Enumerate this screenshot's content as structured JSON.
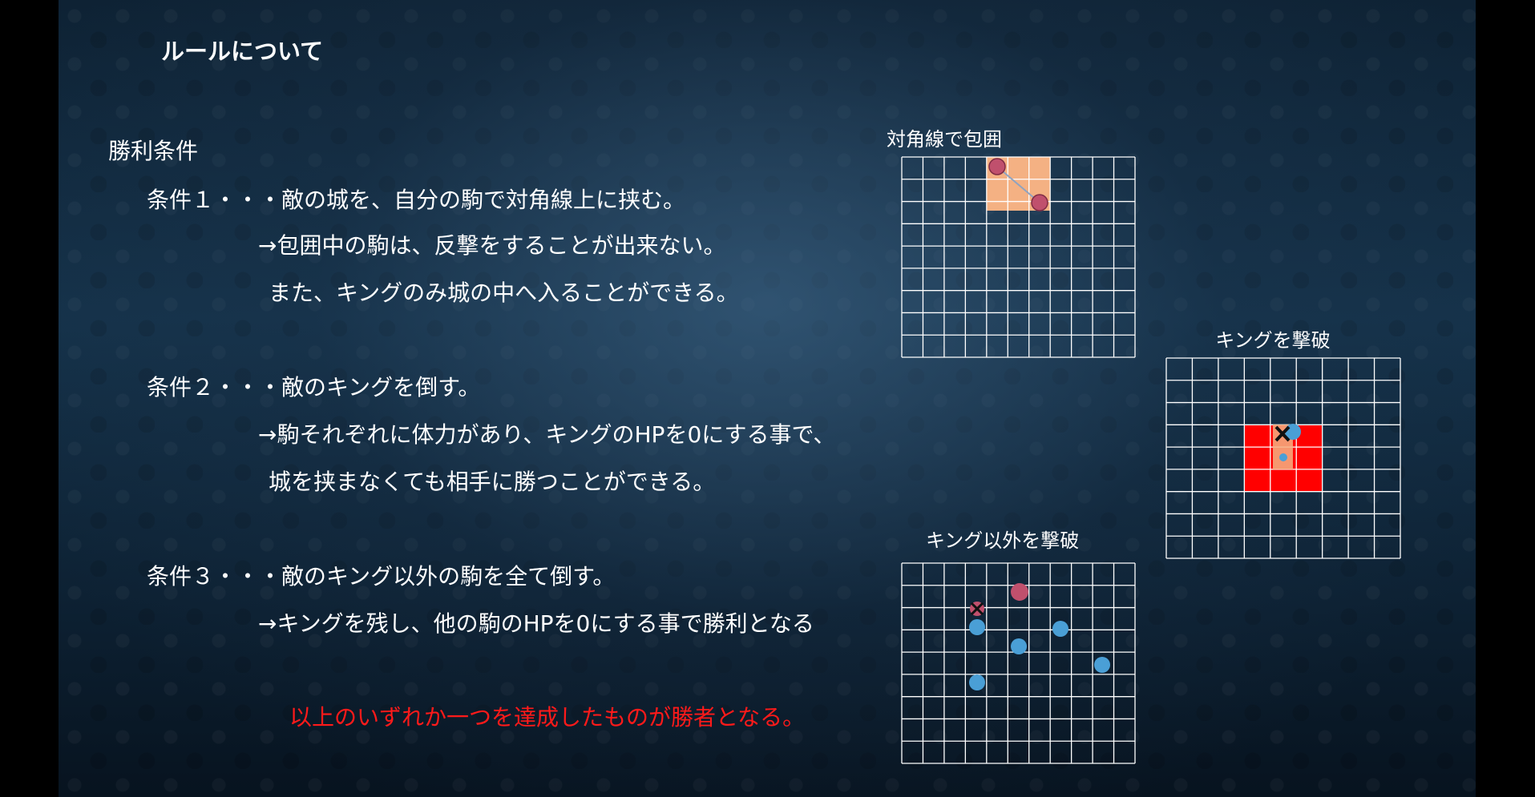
{
  "title": "ルールについて",
  "section_label": "勝利条件",
  "conditions": [
    {
      "heading": "条件１・・・敵の城を、自分の駒で対角線上に挟む。",
      "notes": [
        "→包囲中の駒は、反撃をすることが出来ない。",
        "また、キングのみ城の中へ入ることができる。"
      ]
    },
    {
      "heading": "条件２・・・敵のキングを倒す。",
      "notes": [
        "→駒それぞれに体力があり、キングのHPを0にする事で、",
        "城を挟まなくても相手に勝つことができる。"
      ]
    },
    {
      "heading": "条件３・・・敵のキング以外の駒を全て倒す。",
      "notes": [
        "→キングを残し、他の駒のHPを0にする事で勝利となる"
      ]
    }
  ],
  "conclusion": "以上のいずれか一つを達成したものが勝者となる。",
  "diagrams": {
    "diagonal": {
      "caption": "対角線で包囲",
      "cols": 11,
      "rows": 9
    },
    "king": {
      "caption": "キングを撃破",
      "cols": 9,
      "rows": 9
    },
    "others": {
      "caption": "キング以外を撃破",
      "cols": 11,
      "rows": 9
    }
  },
  "colors": {
    "text": "#ffffff",
    "conclusion": "#ff1a1a",
    "grid_line": "#ffffff",
    "castle_fill": "#f4b183",
    "king_zone": "#ff0000",
    "enemy_piece": "#c0506d",
    "ally_piece": "#4a9fd6"
  }
}
